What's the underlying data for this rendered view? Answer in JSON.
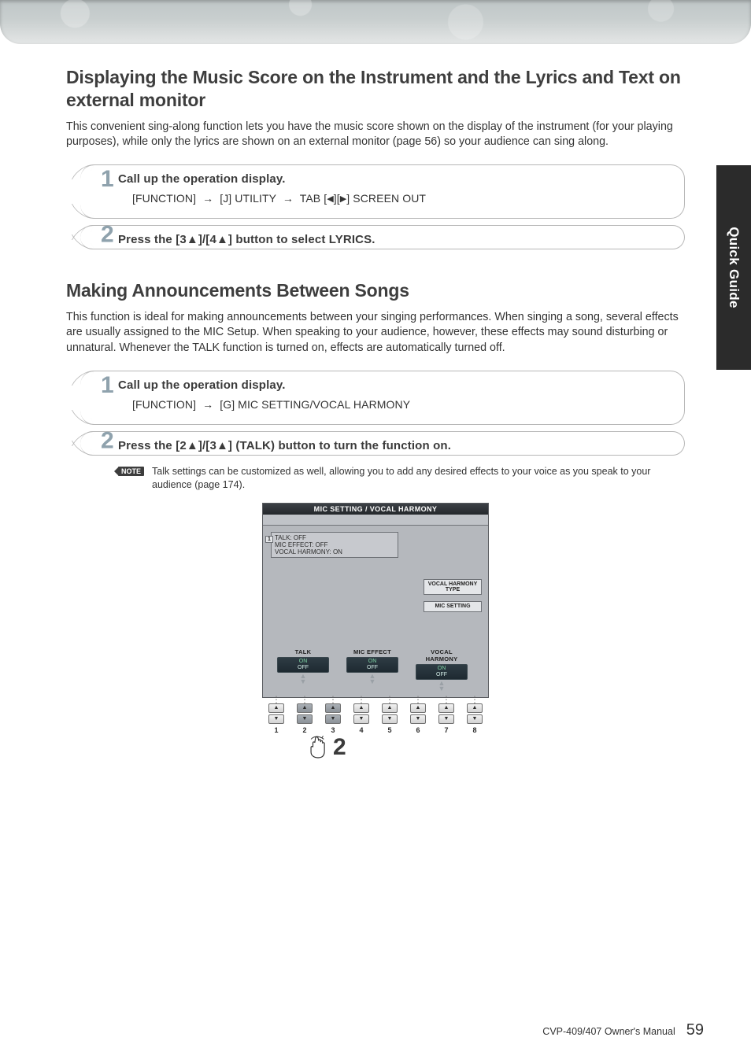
{
  "side_tab": "Quick Guide",
  "footer": {
    "manual": "CVP-409/407 Owner's Manual",
    "page": "59"
  },
  "section1": {
    "title": "Displaying the Music Score on the Instrument and the Lyrics and Text on external monitor",
    "body": "This convenient sing-along function lets you have the music score shown on the display of the instrument (for your playing purposes), while only the lyrics are shown on an external monitor (page 56) so your audience can sing along.",
    "step1": {
      "num": "1",
      "title": "Call up the operation display.",
      "sub_before": "[FUNCTION]",
      "sub_mid1": "[J] UTILITY",
      "sub_mid2": "TAB [",
      "sub_after": "] SCREEN OUT"
    },
    "step2": {
      "num": "2",
      "title": "Press the [3▲]/[4▲] button to select LYRICS."
    }
  },
  "section2": {
    "title": "Making Announcements Between Songs",
    "body": "This function is ideal for making announcements between your singing performances. When singing a song, several effects are usually assigned to the MIC Setup. When speaking to your audience, however, these effects may sound disturbing or unnatural. Whenever the TALK function is turned on, effects are automatically turned off.",
    "step1": {
      "num": "1",
      "title": "Call up the operation display.",
      "sub_before": "[FUNCTION]",
      "sub_after": "[G] MIC SETTING/VOCAL HARMONY"
    },
    "step2": {
      "num": "2",
      "title": "Press the [2▲]/[3▲] (TALK) button to turn the function on."
    },
    "note": {
      "tag": "NOTE",
      "text": "Talk settings can be customized as well, allowing you to add any desired effects to your voice as you speak to your audience (page 174)."
    }
  },
  "screen": {
    "title": "MIC SETTING / VOCAL HARMONY",
    "index": "1",
    "status": {
      "talk": "TALK: OFF",
      "mic": "MIC EFFECT: OFF",
      "vh": "VOCAL HARMONY: ON"
    },
    "side_buttons": {
      "vh_type": "VOCAL HARMONY TYPE",
      "mic_setting": "MIC SETTING"
    },
    "params": [
      {
        "name": "TALK",
        "on": "ON",
        "off": "OFF"
      },
      {
        "name": "MIC EFFECT",
        "on": "ON",
        "off": "OFF"
      },
      {
        "name": "VOCAL HARMONY",
        "on": "ON",
        "off": "OFF"
      }
    ],
    "button_numbers": [
      "1",
      "2",
      "3",
      "4",
      "5",
      "6",
      "7",
      "8"
    ],
    "hand_num": "2"
  }
}
